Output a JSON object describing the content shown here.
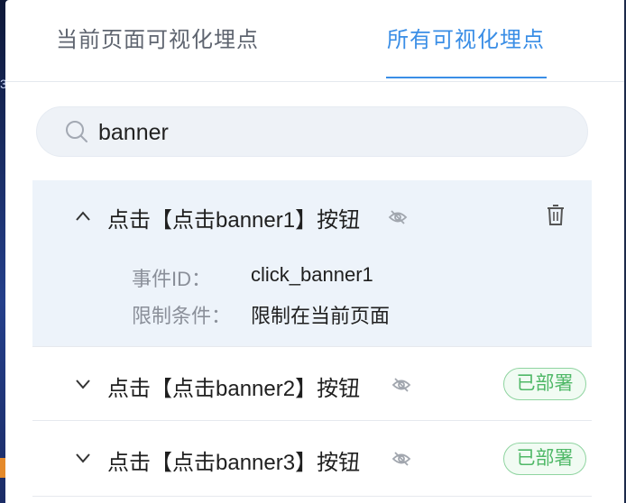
{
  "tabs": [
    {
      "label": "当前页面可视化埋点",
      "active": false
    },
    {
      "label": "所有可视化埋点",
      "active": true
    }
  ],
  "colors": {
    "accent": "#3a8ee6",
    "deployed_badge": "#4fb867",
    "expanded_row_bg": "#edf3fa"
  },
  "search": {
    "value": "banner",
    "icon": "search-icon"
  },
  "events": [
    {
      "title": "点击【点击banner1】按钮",
      "expanded": true,
      "visibility_icon": "eye-off-icon",
      "action_icon": "trash-icon",
      "details": [
        {
          "label": "事件ID：",
          "value": "click_banner1"
        },
        {
          "label": "限制条件：",
          "value": "限制在当前页面"
        }
      ]
    },
    {
      "title": "点击【点击banner2】按钮",
      "expanded": false,
      "visibility_icon": "eye-off-icon",
      "status": "已部署"
    },
    {
      "title": "点击【点击banner3】按钮",
      "expanded": false,
      "visibility_icon": "eye-off-icon",
      "status": "已部署"
    }
  ]
}
